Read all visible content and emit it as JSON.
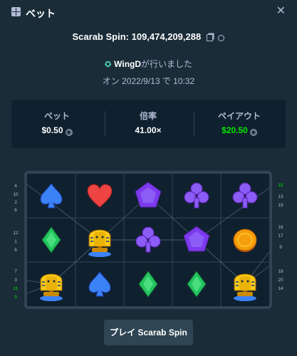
{
  "header": {
    "title": "ベット",
    "icon": "bet-icon",
    "close_icon": "close-icon"
  },
  "game": {
    "name": "Scarab Spin:",
    "id": "109,474,209,288"
  },
  "placed": {
    "user": "WingD",
    "suffix": "が行いました",
    "icon": "star-icon"
  },
  "timestamp": "オン 2022/9/13 で 10:32",
  "stats": {
    "bet_label": "ベット",
    "bet_value": "$0.50",
    "multiplier_label": "倍率",
    "multiplier_value": "41.00×",
    "payout_label": "ペイアウト",
    "payout_value": "$20.50",
    "payout_color": "#00e701"
  },
  "paylines_left": [
    "4",
    "10",
    "2",
    "6",
    "12",
    "1",
    "8",
    "7",
    "3",
    "11",
    "5"
  ],
  "paylines_right": [
    "15",
    "13",
    "19",
    "16",
    "17",
    "9",
    "18",
    "20",
    "14"
  ],
  "reels": [
    [
      "spade",
      "diamond",
      "pharaoh"
    ],
    [
      "heart",
      "pharaoh",
      "spade"
    ],
    [
      "pentagon",
      "club",
      "diamond"
    ],
    [
      "club",
      "pentagon",
      "diamond"
    ],
    [
      "club",
      "coin",
      "pharaoh"
    ]
  ],
  "play_button": "プレイ Scarab Spin"
}
